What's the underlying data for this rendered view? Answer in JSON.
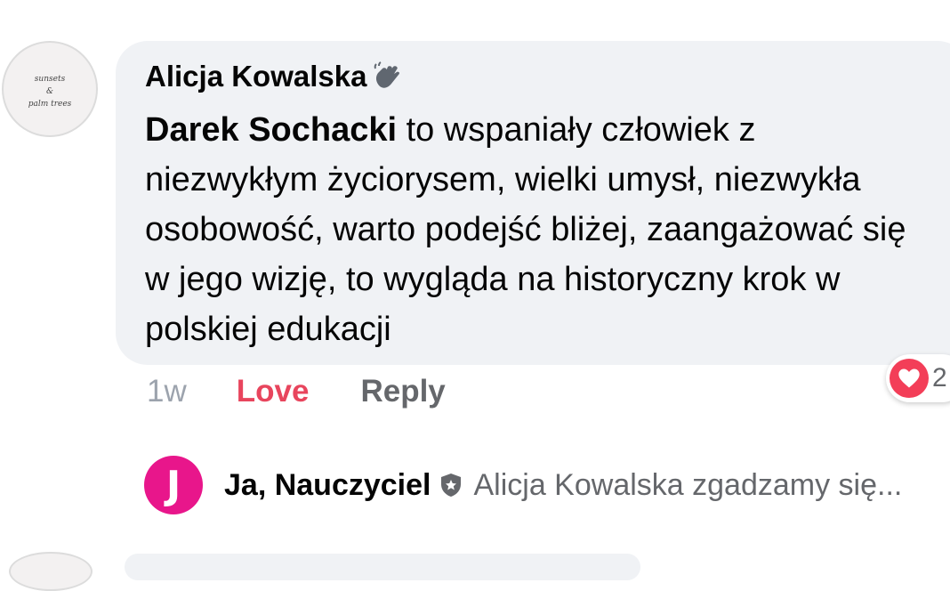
{
  "comment": {
    "avatar_logo_lines": [
      "sunsets",
      "&",
      "palm trees"
    ],
    "author": "Alicja Kowalska",
    "author_badge_icon": "waving-hand-icon",
    "mention": "Darek Sochacki",
    "text": " to wspaniały człowiek z niezwykłym życiorysem, wielki umysł, niezwykła osobowość, warto podejść bliżej, zaangażować się w jego wizję, to wygląda na historyczny krok w polskiej edukacji",
    "time": "1w",
    "love_label": "Love",
    "reply_label": "Reply",
    "reaction_icon": "heart-icon",
    "reaction_count": "2",
    "colors": {
      "love": "#e8455d",
      "bubble": "#f0f2f5",
      "heart": "#f33e58"
    }
  },
  "reply": {
    "avatar_letter": "J",
    "avatar_color": "#e8168b",
    "author": "Ja, Nauczyciel",
    "badge_icon": "shield-badge-icon",
    "preview": "Alicja Kowalska zgadzamy się..."
  }
}
